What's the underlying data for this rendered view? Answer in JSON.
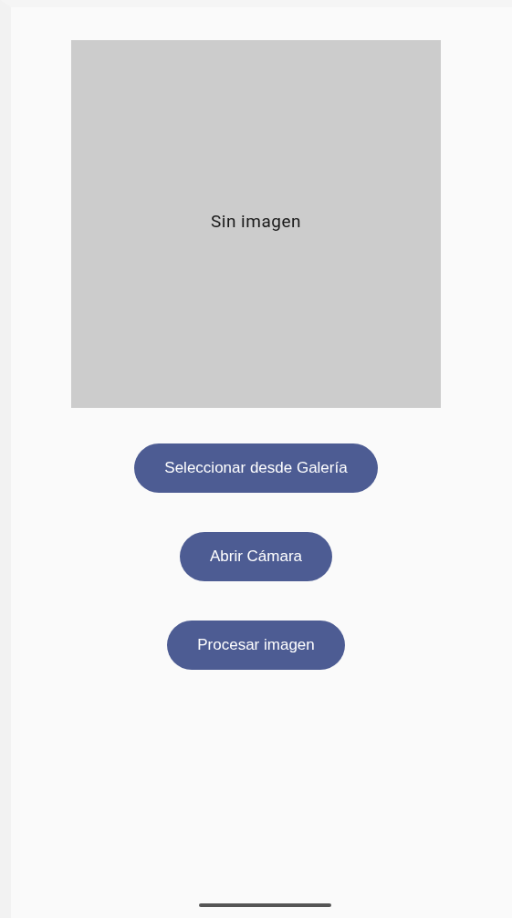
{
  "image_preview": {
    "kind": "picture_placeholder",
    "text": "Sin imagen"
  },
  "buttons": [
    {
      "label": "Seleccionar desde Galería"
    },
    {
      "label": "Abrir Cámara"
    },
    {
      "label": "Procesar imagen"
    }
  ]
}
